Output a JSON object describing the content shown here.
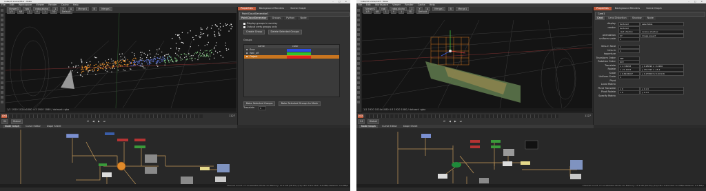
{
  "left": {
    "titlebar": {
      "title": "nuke/v0 scene/lidar - Nuke",
      "controls": "– □ ×"
    },
    "menu": [
      "File",
      "Edit",
      "Workspace",
      "Viewer",
      "Render",
      "Cache",
      "Help"
    ],
    "viewer": {
      "tab": "Viewer1",
      "row1": [
        "rgb",
        "rgba.alpha",
        "1",
        "Y",
        "A",
        "Merge1",
        "B",
        "Merge1"
      ],
      "row2": [
        "1/3",
        "f/8",
        "1",
        "Y",
        "1",
        "3D",
        "Default"
      ],
      "info": "1/1  1920  1024x1080  4:3  1920 1080 / dataset: rgba"
    },
    "timeline": {
      "frame": "1001",
      "fps": "24",
      "mode": "Global",
      "end": "1127"
    },
    "props_tabs": [
      "Properties",
      "Background Renders",
      "Scene Graph"
    ],
    "node_name": "PointCloudGenerator1",
    "knob_tabs": [
      "PointCloudGenerator",
      "Groups",
      "Python",
      "Node"
    ],
    "checks": [
      "Display groups in overlay",
      "Output verts groups only"
    ],
    "create_buttons": [
      "Create Group",
      "Delete Selected Groups"
    ],
    "groups_label": "Groups",
    "table": {
      "headers": [
        "name",
        "color"
      ],
      "rows": [
        {
          "name": "floor",
          "color": "#2b4de8"
        },
        {
          "name": "Wall_aft",
          "color": "#2fc42f"
        },
        {
          "name": "Object",
          "color": "#e5221b"
        }
      ]
    },
    "bake_buttons": [
      "Bake Selected Groups",
      "Bake Selected Groups to Mesh"
    ],
    "tessellate": {
      "label": "Tessalate",
      "value": "0"
    },
    "graph_tabs": [
      "Node Graph",
      "Curve Editor",
      "Dope Sheet"
    ],
    "status": "Channel Count: 77  Localization Mode: On  Memory: 17.9 GB (56.5%) (79)  CPU: 0.9%  Disk: 8.4 MB/s  Network: 0.0 MB/s"
  },
  "right": {
    "titlebar": {
      "title": "nuke/v0 scene/card - Nuke",
      "controls": "– □ ×"
    },
    "menu": [
      "File",
      "Edit",
      "Workspace",
      "Viewer",
      "Render",
      "Cache",
      "Help"
    ],
    "viewer": {
      "tab": "Viewer1",
      "row1": [
        "rgb",
        "rgba.alpha",
        "1",
        "Y",
        "A",
        "Merge1",
        "B",
        "Merge1"
      ],
      "row2": [
        "1/3",
        "f/8",
        "1",
        "Y",
        "1",
        "3D",
        "Default"
      ],
      "info": "1/1  1920  1024x1080  4:3  1920 1080 / dataset: rgba"
    },
    "timeline": {
      "frame": "1001",
      "fps": "24",
      "mode": "Global",
      "end": "1127"
    },
    "props_tabs": [
      "Properties",
      "Background Renders",
      "Scene Graph"
    ],
    "node_name": "Card1",
    "knob_tabs": [
      "Card",
      "Lens Distortion",
      "Shadow",
      "Node"
    ],
    "knobs": [
      {
        "label": "display",
        "value": "textured",
        "extra": "selectable"
      },
      {
        "label": "render",
        "value": "textured",
        "extra": ""
      },
      {
        "label": "",
        "value": "cast shadow",
        "extra": "receive shadow"
      },
      {
        "label": "orientation",
        "value": "XY",
        "extra": "image aspect"
      },
      {
        "label": "uniform scale",
        "value": "1",
        "extra": ""
      },
      {
        "label": "",
        "value": "",
        "extra": ""
      },
      {
        "label": "lens-in focal",
        "value": "1",
        "extra": ""
      },
      {
        "label": "lens-in haperture",
        "value": "1",
        "extra": ""
      },
      {
        "label": "",
        "value": "",
        "extra": ""
      },
      {
        "label": "Transform Order",
        "value": "SRT",
        "extra": ""
      },
      {
        "label": "Rotation Order",
        "value": "ZXY",
        "extra": ""
      },
      {
        "label": "Translate",
        "value": "x -1.56093",
        "extra": "y 0.28099  z -3.4266"
      },
      {
        "label": "Rotate",
        "value": "x -21.1003",
        "extra": "y 132.593  z -15.2"
      },
      {
        "label": "Scale",
        "value": "x 0.6226207",
        "extra": "y 0.278003  z 0.26116"
      },
      {
        "label": "Uniform Scale",
        "value": "1",
        "extra": ""
      },
      {
        "label": "Pivot",
        "value": "",
        "extra": ""
      },
      {
        "label": "Local Matrix",
        "value": "",
        "extra": ""
      },
      {
        "label": "Pivot Translate",
        "value": "x 0",
        "extra": "y 0  z 0"
      },
      {
        "label": "Pivot Rotate",
        "value": "x 0",
        "extra": "y 0  z 0"
      },
      {
        "label": "Specify Matrix",
        "value": "",
        "extra": ""
      }
    ],
    "graph_tabs": [
      "Node Graph",
      "Curve Editor",
      "Dope Sheet"
    ],
    "status": "Channel Count: 77  Localization Mode: On  Memory: 17.9 GB (56.5%) (79)  CPU: 0.9%  Disk: 8.4 MB/s  Network: 0.0 MB/s"
  },
  "colors": {
    "accent": "#c05a3b",
    "wire": "#c69a5a",
    "orange": "#e08a2a"
  }
}
